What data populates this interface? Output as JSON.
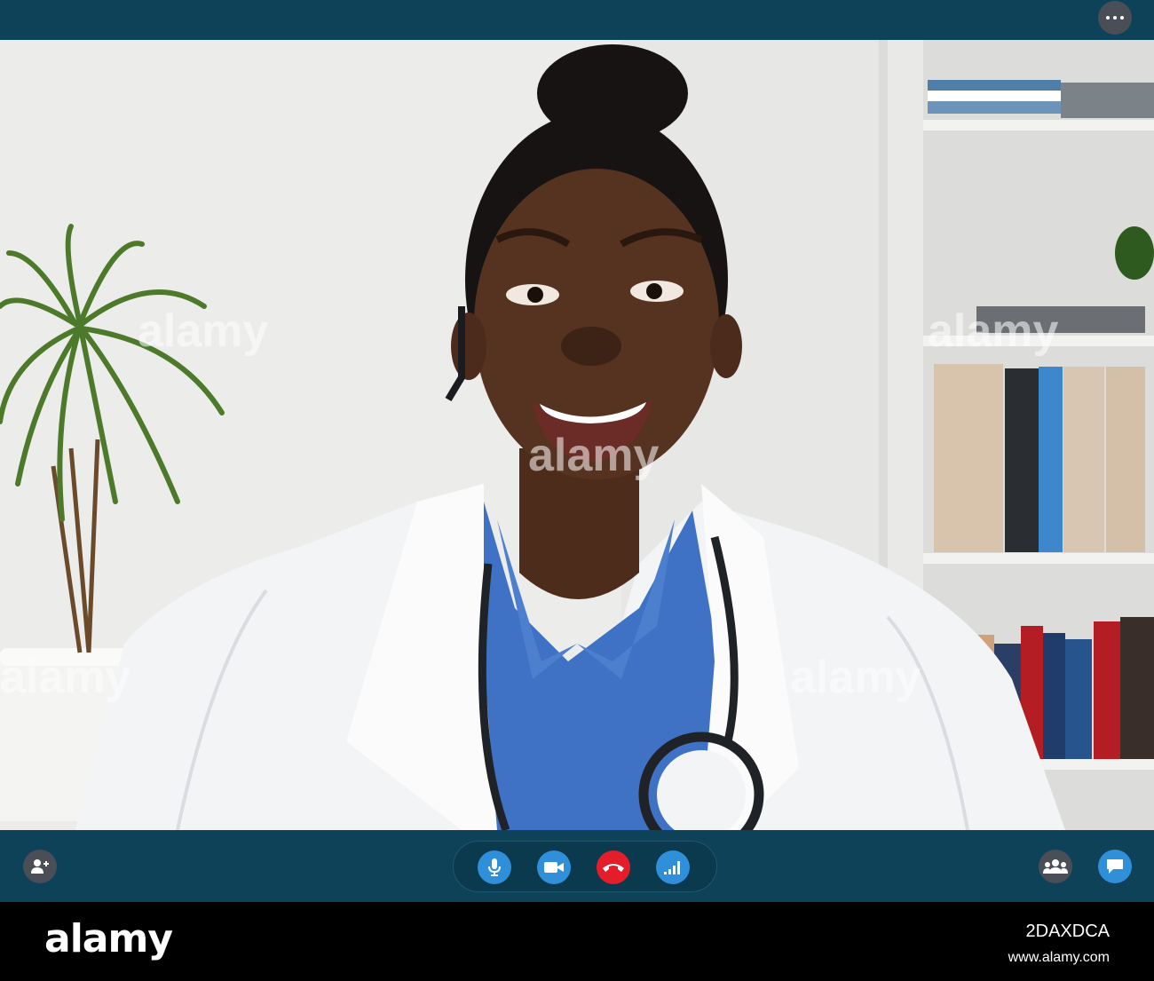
{
  "call": {
    "more_icon": "more-horizontal-icon",
    "add_participant_icon": "add-user-icon",
    "mic_icon": "microphone-icon",
    "camera_icon": "video-camera-icon",
    "hangup_icon": "phone-hangup-icon",
    "signal_icon": "signal-bars-icon",
    "participants_icon": "group-icon",
    "chat_icon": "chat-bubble-icon",
    "colors": {
      "bar": "#0d4259",
      "blue": "#2f8fd8",
      "red": "#e31d2a",
      "grey": "#4a4f57"
    }
  },
  "watermark": {
    "text": "alamy"
  },
  "footer": {
    "logo": "alamy",
    "image_id": "2DAXDCA",
    "site": "www.alamy.com"
  }
}
